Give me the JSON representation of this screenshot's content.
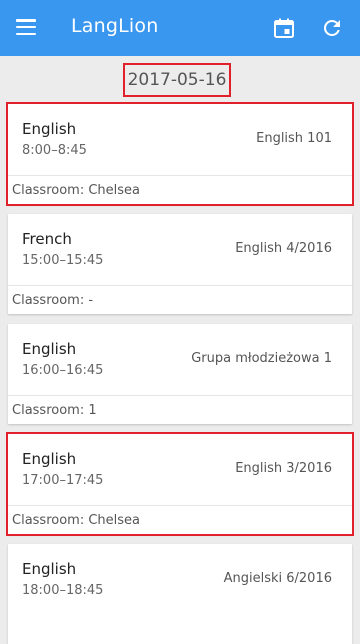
{
  "app": {
    "title": "LangLion"
  },
  "icons": {
    "menu": "menu-icon",
    "calendar": "calendar-icon",
    "refresh": "refresh-icon"
  },
  "colors": {
    "appbar": "#3a97ef",
    "highlight": "#e0202a"
  },
  "date": "2017-05-16",
  "lessons": [
    {
      "subject": "English",
      "time": "8:00–8:45",
      "group": "English 101",
      "classroom": "Classroom: Chelsea"
    },
    {
      "subject": "French",
      "time": "15:00–15:45",
      "group": "English 4/2016",
      "classroom": "Classroom: -"
    },
    {
      "subject": "English",
      "time": "16:00–16:45",
      "group": "Grupa młodzieżowa 1",
      "classroom": "Classroom: 1"
    },
    {
      "subject": "English",
      "time": "17:00–17:45",
      "group": "English 3/2016",
      "classroom": "Classroom: Chelsea"
    },
    {
      "subject": "English",
      "time": "18:00–18:45",
      "group": "Angielski 6/2016",
      "classroom": ""
    }
  ]
}
